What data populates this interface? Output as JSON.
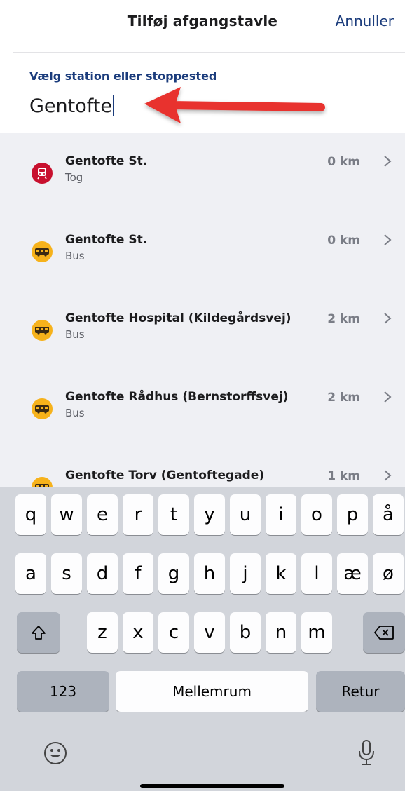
{
  "header": {
    "title": "Tilføj afgangstavle",
    "cancel_label": "Annuller"
  },
  "search": {
    "label": "Vælg station eller stoppested",
    "value": "Gentofte"
  },
  "results": [
    {
      "name": "Gentofte St.",
      "type": "Tog",
      "distance": "0 km",
      "icon": "train-icon"
    },
    {
      "name": "Gentofte St.",
      "type": "Bus",
      "distance": "0 km",
      "icon": "bus-icon"
    },
    {
      "name": "Gentofte Hospital (Kildegårdsvej)",
      "type": "Bus",
      "distance": "2 km",
      "icon": "bus-icon"
    },
    {
      "name": "Gentofte Rådhus (Bernstorffsvej)",
      "type": "Bus",
      "distance": "2 km",
      "icon": "bus-icon"
    },
    {
      "name": "Gentofte Torv (Gentoftegade)",
      "type": "Bus",
      "distance": "1 km",
      "icon": "bus-icon"
    }
  ],
  "colors": {
    "brand": "#1b3c7c",
    "train": "#c8102e",
    "bus": "#f6b21b",
    "arrow": "#e8332f"
  },
  "keyboard": {
    "row1": [
      "q",
      "w",
      "e",
      "r",
      "t",
      "y",
      "u",
      "i",
      "o",
      "p",
      "å"
    ],
    "row2": [
      "a",
      "s",
      "d",
      "f",
      "g",
      "h",
      "j",
      "k",
      "l",
      "æ",
      "ø"
    ],
    "row3": [
      "z",
      "x",
      "c",
      "v",
      "b",
      "n",
      "m"
    ],
    "numbers_label": "123",
    "space_label": "Mellemrum",
    "return_label": "Retur"
  }
}
